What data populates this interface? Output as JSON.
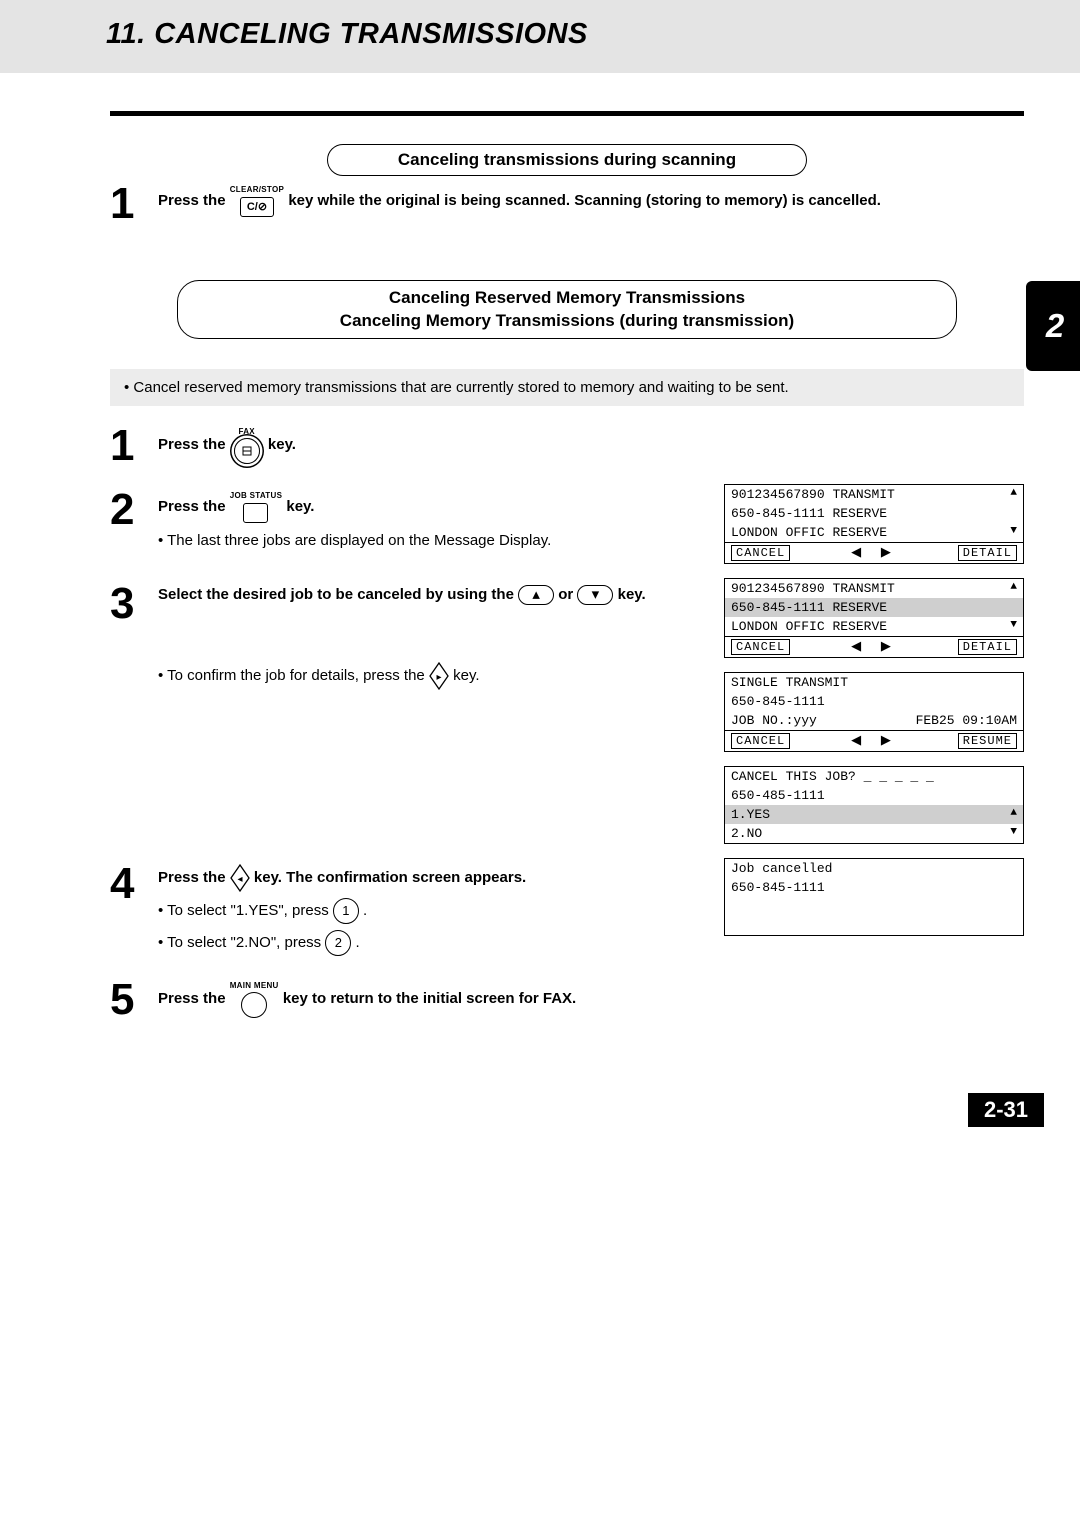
{
  "header": {
    "title": "11. CANCELING TRANSMISSIONS"
  },
  "tab": "2",
  "pill1": "Canceling transmissions during scanning",
  "stepA1": {
    "pre": "Press the ",
    "key_top": "CLEAR/STOP",
    "key_text": "C/⊘",
    "post": " key while the original is being scanned. Scanning (storing to memory) is cancelled."
  },
  "pill2_line1": "Canceling Reserved Memory Transmissions",
  "pill2_line2": "Canceling Memory Transmissions (during transmission)",
  "note": "• Cancel reserved memory transmissions that are currently stored to memory and waiting to be sent.",
  "s1": {
    "pre": "Press the ",
    "key_top": "FAX",
    "post": " key."
  },
  "s2": {
    "pre": "Press the ",
    "key_top": "JOB STATUS",
    "post": " key.",
    "sub": "• The last three jobs are displayed on the Message Display."
  },
  "s3": {
    "pre": "Select the desired job to be canceled by using the ",
    "mid": "or",
    "post": " key.",
    "sub_pre": "• To confirm the job for details, press the ",
    "sub_post": " key."
  },
  "s4": {
    "pre": "Press the ",
    "post": " key.  The confirmation screen appears.",
    "b1_pre": "• To select \"1.YES\", press ",
    "b1_key": "1",
    "b1_post": " .",
    "b2_pre": "• To select \"2.NO\", press ",
    "b2_key": "2",
    "b2_post": " ."
  },
  "s5": {
    "pre": "Press the ",
    "key_top": "MAIN MENU",
    "post": " key to return to the initial screen for FAX."
  },
  "lcd1": {
    "r1a": "901234567890",
    "r1b": "TRANSMIT",
    "r2a": "650-845-1111",
    "r2b": "RESERVE",
    "r3a": "LONDON OFFIC",
    "r3b": "RESERVE",
    "btnL": "CANCEL",
    "btnR": "DETAIL"
  },
  "lcd2": {
    "r1a": "901234567890",
    "r1b": "TRANSMIT",
    "r2a": "650-845-1111",
    "r2b": "RESERVE",
    "r3a": "LONDON OFFIC",
    "r3b": "RESERVE",
    "btnL": "CANCEL",
    "btnR": "DETAIL"
  },
  "lcd3": {
    "r1": "SINGLE TRANSMIT",
    "r2": "650-845-1111",
    "r3a": "JOB NO.:yyy",
    "r3b": "FEB25 09:10AM",
    "btnL": "CANCEL",
    "btnR": "RESUME"
  },
  "lcd4": {
    "r1": "CANCEL THIS JOB? _ _ _ _ _",
    "r2": "650-485-1111",
    "r3": "1.YES",
    "r4": "2.NO"
  },
  "lcd5": {
    "r1": "Job cancelled",
    "r2": "650-845-1111"
  },
  "pagenum": "2-31"
}
